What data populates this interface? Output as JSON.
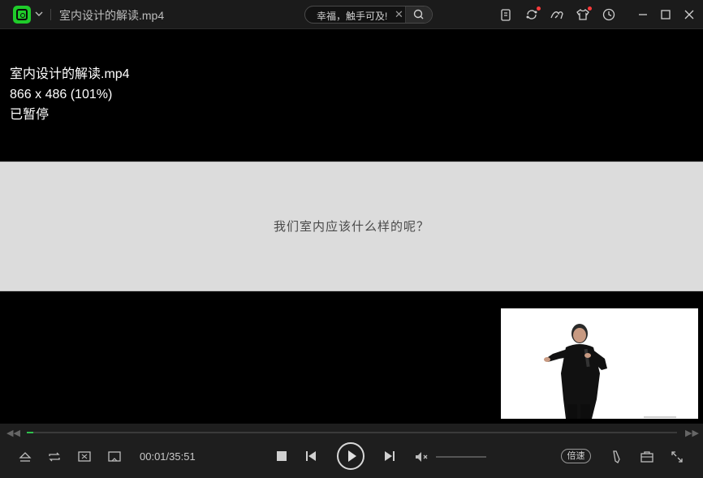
{
  "titlebar": {
    "window_title": "室内设计的解读.mp4",
    "search_text": "幸福，触手可及!",
    "search_clear": "✕",
    "icons": [
      "app-logo-icon",
      "dropdown-icon",
      "clipboard-icon",
      "sync-icon",
      "bird-icon",
      "shirt-icon",
      "history-icon",
      "minimize-icon",
      "maximize-icon",
      "close-icon"
    ],
    "accent": "#1fcc2a",
    "badge_color": "#ff3b3b"
  },
  "overlay": {
    "filename": "室内设计的解读.mp4",
    "resolution": "866 x 486 (101%)",
    "status": "已暂停"
  },
  "slide": {
    "text": "我们室内应该什么样的呢？"
  },
  "controls": {
    "seek_left": "◀◀",
    "seek_right": "▶▶",
    "current_time": "00:01/35:51",
    "progress": 0.0005,
    "speed_label": "倍速",
    "mute_mark": "✕"
  }
}
